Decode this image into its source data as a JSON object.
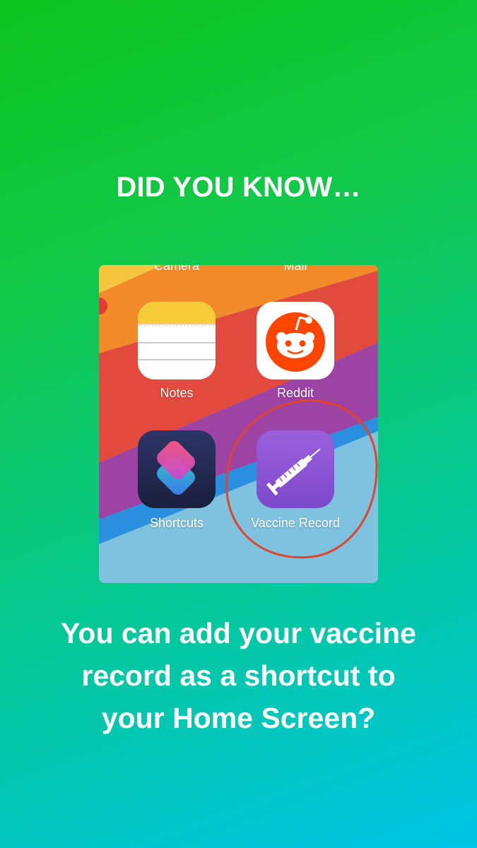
{
  "headline": "DID YOU KNOW…",
  "phone": {
    "top_labels": {
      "left": "Camera",
      "right": "Mail"
    },
    "apps": [
      {
        "label": "Notes",
        "icon": "notes-icon"
      },
      {
        "label": "Reddit",
        "icon": "reddit-icon"
      },
      {
        "label": "Shortcuts",
        "icon": "shortcuts-icon"
      },
      {
        "label": "Vaccine Record",
        "icon": "syringe-icon"
      }
    ]
  },
  "caption": {
    "line1": "You can add your vaccine",
    "line2": "record as a shortcut to",
    "line3": "your Home Screen?"
  },
  "colors": {
    "gradient_top": "#0fc41e",
    "gradient_bottom": "#00c6e8",
    "annotation_circle": "#e0442c",
    "vaccine_icon": "#8a55d6"
  }
}
